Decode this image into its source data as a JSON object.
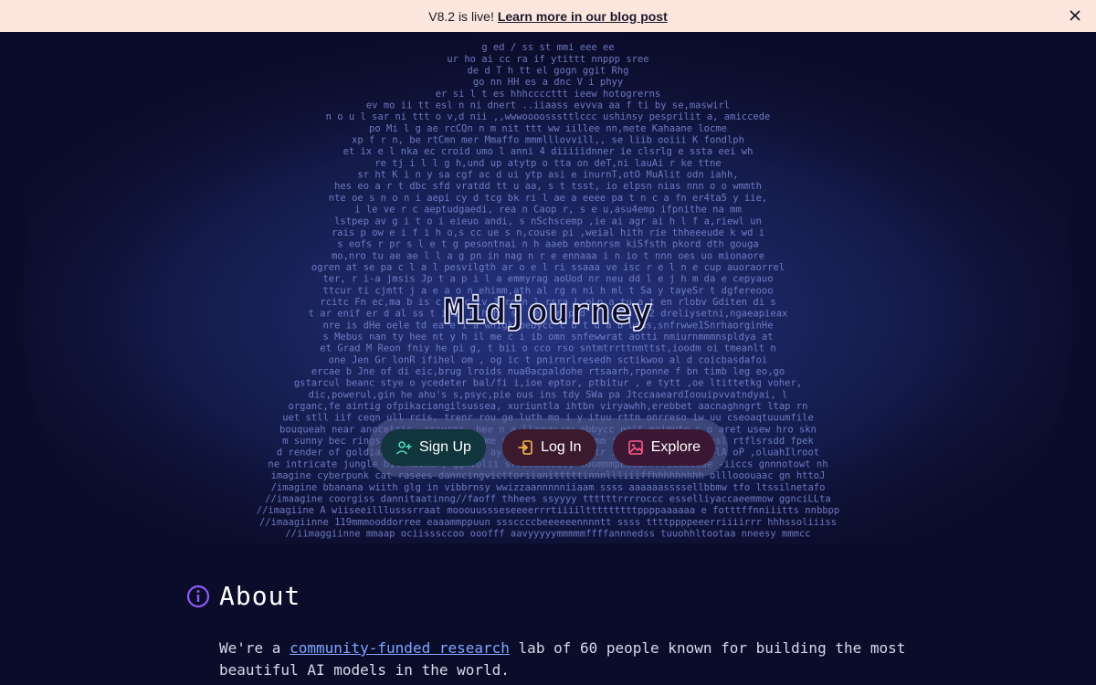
{
  "banner": {
    "prefix": "V8.2 is live!",
    "link": "Learn more in our blog post",
    "close_icon": "close-icon"
  },
  "hero": {
    "logo_text": "Midjourney",
    "ascii_lines": [
      "g  ed  /      ss          st       mmi          eee ee",
      "ur   ho  ai     cc   ra   if     ytittt   nnppp   sree",
      "de   d     T  h   tt  el    gogn   ggit   Rhg",
      "go  nn  HH   es  a   dnc   V  i      phyy",
      "er  si  l   t   es   hhhccccttt   ieew  hotogrerns",
      "ev   mo  ii  tt   esl  n   ni   dnert ..iiaass   evvva aa   f ti   by se,maswirl",
      "n   o   u    l   sar ni   ttt o   v,d nii ,,wwwoooosssttlccc   ushinsy pesprilit  a, amiccede",
      "po  Mi   l   g   ae   rcCQn n m nit   ttt   ww   iillee  nn,mete   Kahaane locme",
      "xp  f    r   n,  be   rtCmn  mer   Mmaffo   mmmlllovvill,, se   liib   ooiii   K  fondlph",
      "et  ix   e   l   nka ec   croid umo l anni  4   diiiiidnner   ie  clsrlg  e ssta eei wh",
      "re  tj   i   l   l   g  h,und up atytp   o tta on   deT,ni lauAi  r ke  ttne",
      "sr  ht   K   i   n  y   sa cgf   ac d  ui  ytp   asi   e   inurnT,otO MuAlit   odn iahh,",
      "hes  eo  a   r  t  dbc sfd vratdd tt  u  aa,  s  t  tsst, io   elpsn nias   nnn  o o wmmth",
      "nte  oe  s   n  o   n i aepi cy d tcg bk  ri   l ae   a  eeee pa   t n c   a  fn er4ta5 y iie,",
      "i le   ve   r   c   aeptudgaedi,   rea   n Caop  r, s  e  u,asu4emp   ifpnithe na mm",
      "lstpep   av   g  i   t  o i   eieuo andi,   s   nSchscemp   ,ie ai agr ai   h l f a,riewl un",
      "rais p  ow   e   i   f i h  o,s cc ue   s   n,couse pi ,weial hith rie   thheeeude k wd i",
      "s eofs   r  pr   s   l   e   t  g  pesontnai n   h  aaeb enbnnrsm kiSfsth pkord   dth gouga",
      "mo,nro   tu  ae  ae   l   l   a g  pn in nag n r   e   ennaaa   i  n io   t  nnn  oes uo mionaore",
      "ogren   at   se  pa  c   l   a l  pesvilgth  ar o   e  l  ri ssaaa   ve  isc   r  e l  n   e cup auoraorrel",
      "ter,  r   i-a  jmsis   Jp   t   a   p i l   a emmyrag   aoUod   nr  neu  dd  l e j  h   m  da   e cepyauo",
      "ttcur   ti   cjmtt   j  a   e   a   o n   ehimm,ath al   rg   n  ni  h   ml  t Sa   y tayeSr t dgfereooo",
      "rcitc   Fn   ec,ma   b   is   c   t nc   iv,3yrc n l  rsra L   oLp a   tu a   t en   rlobv Gditen  di s",
      "t ar   enif   er   d   al  ss   t  i  ia m hyht  sn eei   en  p   d a   S   utm ,u2 dreliysetni,ngaeapieax",
      "nre   is  dHe  oele   td   ea   e   i  a   whigkupebycc  c  b   t d  a   b   uoas,snfrwwe1SnrhaorginHe",
      "s   Mebus   nan   ty hee   nt  y   h   il  me   c  i  ib   omn snfewwrat aotti nmiurnmmmnspldya at",
      "et  Grad M   Reon   fniy he   pi   g,   t   bii   o   cco   rso sntmtrrttnmttst,ioodm oi   tmeanlt n",
      "one Jen Gr   lonR   ifihel   om ,   og   ic   t pnirnrlresedh sctikwoo al  d coicbasdafoi",
      "ercae b Jne   of di   eic,brug  lroids  nua0acpaldohe rtsaarh,rponne  f bn timb leg eo,go",
      "gstarcul beanc stye o   ycedeter   bal/fi   i,ioe   eptor,   ptbitur , e  tytt ,oe   ltittetkg voher,",
      "dic,powerul,gin he ahu's   s,psyc,pie   ous ins   tdy  SWa pa JtccaaeardIoouipvvatndyai, l",
      "organc,fe aintig  ofpikaciangilsussea,   xuriuntla   ihtbn viryawhh,erebbet aacnaghngrt ltap rn",
      "uet stll iif ceqn ull rcis, trenr rou   ge luth mo   i y ituu  rttn onrreso  iw  uu  cseoaqtuuumfile",
      "bouqueah near anocetric, crcurer, hee   n a llaoww ww   ebbycc noit noipute s  o  aret usew hro skn",
      "m sunny bec rings, geom albrecht nime styl   ylle.. tte  mm   if eccnuroc sei  nosl   rtflsrsdd fpek",
      "d render of goldiandscape bygoogies, ayle   occocco  iinnttr   iccs i oediv ,nusolA   oP ,oluahIlroot",
      "ne intricate jungle bit  hacker, gghiblii srressssess, coommmpEaaarrrreaaaaaae   -iiccs  gnnnotowt nh",
      "imagine cyberpunk cat rasees danncingvicttoriianitttttinnnllliiiffhhhhhhhhh   olllooouaac gn httoJ",
      "/imagine bbanana wiith glg in  vibbrnsy  wwizzaannnnniiaam  ssss   aaaaaassssellbbmw  tfo ltssilnetafo",
      "//imaagine coorgiss dannitaatinng//faoff  thhees  ssyyyy   ttttttrrrroccc  esselliyaccaeemmow ggnciLLta",
      "//imagiine  A wiiseeilllusssrraat mooouussseseeeerrrtiiiiltttttttttppppaaaaaa  e  fotttffnniiitts nnbbpp",
      "//imaagiinne 119mmmooddorree eaaammppuun  sssccccbeeeeeennnntt ssss   ttttppppeeerriiiirrr  hhhssoliiiss",
      "//iimaggiinne mmaap  ociisssccoo ooofff   aavyyyyymmmmmffffannnedss   tuuohhltootaa  nneesy  mmmcc"
    ],
    "logo": "midjourney-logo"
  },
  "cta": {
    "signup": {
      "label": "Sign Up",
      "icon": "user-plus-icon"
    },
    "login": {
      "label": "Log In",
      "icon": "login-icon"
    },
    "explore": {
      "label": "Explore",
      "icon": "image-icon"
    }
  },
  "about": {
    "heading": "About",
    "heading_icon": "info-icon",
    "text_before": "We're a",
    "link": "community-funded research",
    "text_after": "lab of 60 people known for building the most beautiful AI models in the world."
  },
  "colors": {
    "background": "#0b0c2a",
    "banner": "#fde6dd",
    "ascii": "#7c8bd6",
    "link": "#7fa7ff",
    "accent_purple": "#8b5cf6"
  }
}
